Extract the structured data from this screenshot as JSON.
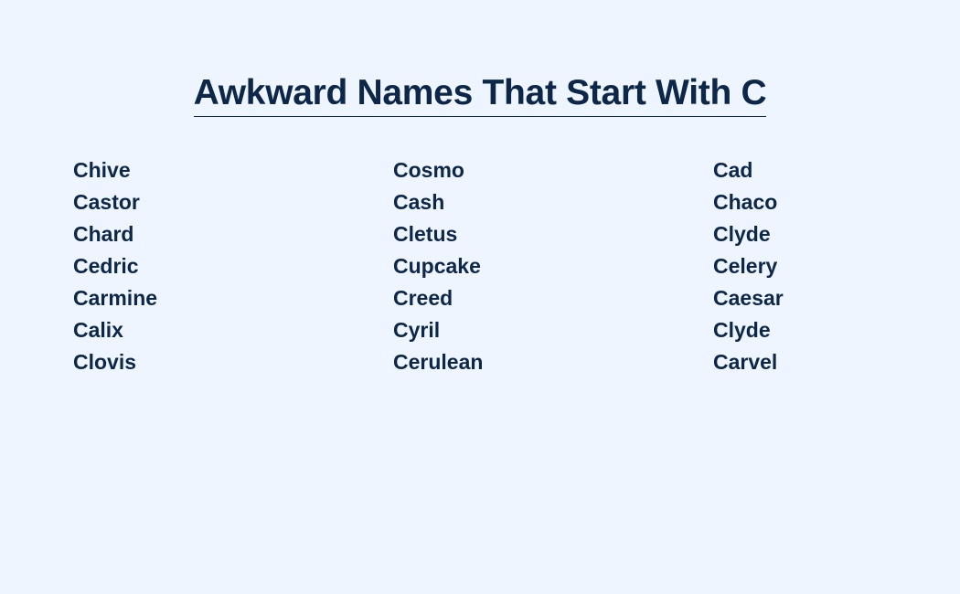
{
  "title": "Awkward Names That Start With C",
  "columns": [
    [
      "Chive",
      "Castor",
      "Chard",
      "Cedric",
      "Carmine",
      "Calix",
      "Clovis"
    ],
    [
      "Cosmo",
      "Cash",
      "Cletus",
      "Cupcake",
      "Creed",
      "Cyril",
      "Cerulean"
    ],
    [
      "Cad",
      "Chaco",
      "Clyde",
      "Celery",
      "Caesar",
      "Clyde",
      "Carvel"
    ]
  ]
}
